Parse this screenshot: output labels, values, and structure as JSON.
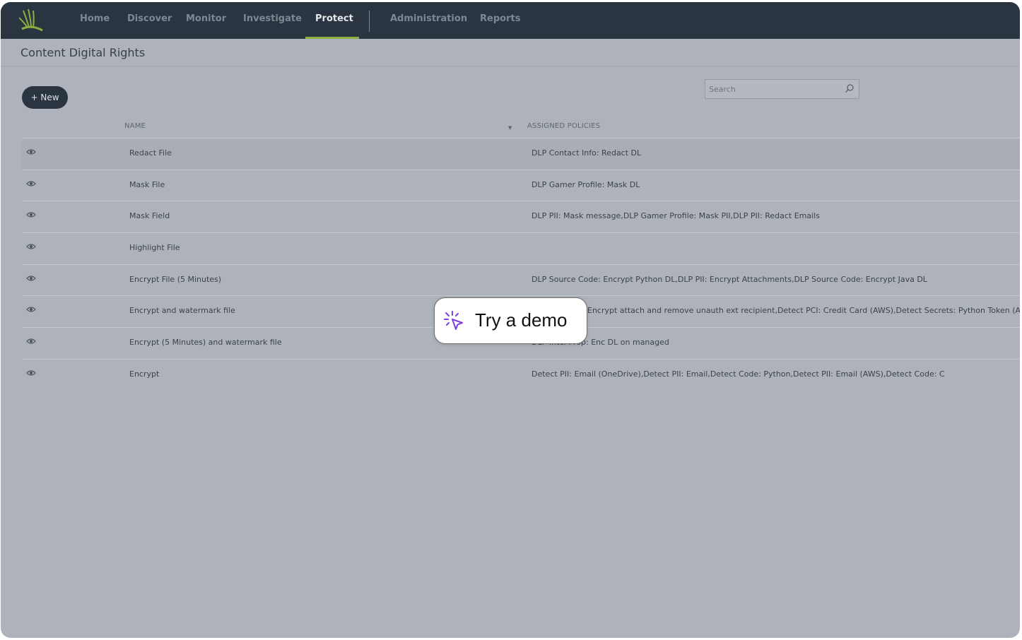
{
  "nav": {
    "items": [
      "Home",
      "Discover",
      "Monitor",
      "Investigate",
      "Protect",
      "Administration",
      "Reports"
    ],
    "active": "Protect"
  },
  "page": {
    "title": "Content Digital Rights"
  },
  "toolbar": {
    "new_label": "+ New",
    "search_placeholder": "Search"
  },
  "table": {
    "columns": [
      "NAME",
      "ASSIGNED POLICIES"
    ],
    "rows": [
      {
        "name": "Redact File",
        "policies": "DLP Contact Info: Redact DL"
      },
      {
        "name": "Mask File",
        "policies": "DLP Gamer Profile: Mask DL"
      },
      {
        "name": "Mask Field",
        "policies": "DLP PII: Mask message,DLP Gamer Profile: Mask PII,DLP PII: Redact Emails"
      },
      {
        "name": "Highlight File",
        "policies": ""
      },
      {
        "name": "Encrypt File (5 Minutes)",
        "policies": "DLP Source Code: Encrypt Python DL,DLP PII: Encrypt Attachments,DLP Source Code: Encrypt Java DL"
      },
      {
        "name": "Encrypt and watermark file",
        "policies": "Encrypt attach and remove unauth ext recipient,Detect PCI: Credit Card (AWS),Detect Secrets: Python Token (AWS),DL"
      },
      {
        "name": "Encrypt (5 Minutes) and watermark file",
        "policies": "DLP Intel Prop: Enc DL on managed"
      },
      {
        "name": "Encrypt",
        "policies": "Detect PII: Email (OneDrive),Detect PII: Email,Detect Code: Python,Detect PII: Email (AWS),Detect Code: C"
      }
    ]
  },
  "demo": {
    "label": "Try a demo"
  },
  "colors": {
    "nav_bg": "#2a3541",
    "accent": "#8fae3f",
    "demo_icon": "#7b3fe4"
  }
}
